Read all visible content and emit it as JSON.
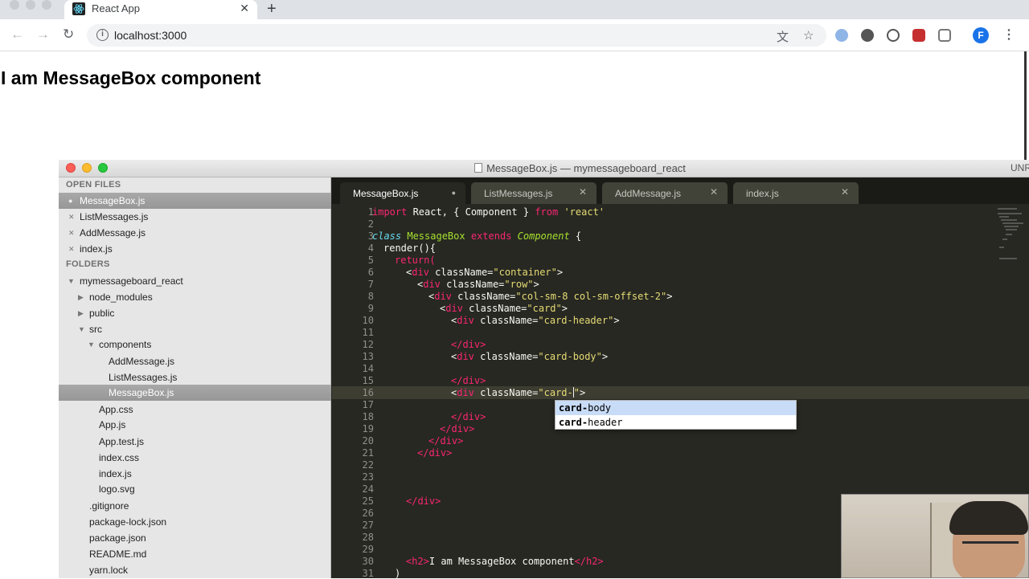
{
  "browser": {
    "tab_title": "React App",
    "tab_close": "✕",
    "new_tab": "+",
    "url": "localhost:3000",
    "profile_initial": "F",
    "back_icon": "←",
    "forward_icon": "→",
    "reload_icon": "↻",
    "translate_icon": "文",
    "bookmark_icon": "☆",
    "menu_icon": "⋮"
  },
  "page": {
    "heading": "I am MessageBox component"
  },
  "editor": {
    "window_title": "MessageBox.js — mymessageboard_react",
    "unregistered": "UNR",
    "sidebar": {
      "open_files_header": "OPEN FILES",
      "open_files": [
        {
          "name": "MessageBox.js",
          "mark": "●"
        },
        {
          "name": "ListMessages.js",
          "mark": "✕"
        },
        {
          "name": "AddMessage.js",
          "mark": "✕"
        },
        {
          "name": "index.js",
          "mark": "✕"
        }
      ],
      "folders_header": "FOLDERS",
      "tree": [
        {
          "name": "mymessageboard_react",
          "arrow": "▼"
        },
        {
          "name": "node_modules",
          "arrow": "▶"
        },
        {
          "name": "public",
          "arrow": "▶"
        },
        {
          "name": "src",
          "arrow": "▼"
        },
        {
          "name": "components",
          "arrow": "▼"
        },
        {
          "name": "AddMessage.js",
          "arrow": ""
        },
        {
          "name": "ListMessages.js",
          "arrow": ""
        },
        {
          "name": "MessageBox.js",
          "arrow": ""
        },
        {
          "name": "App.css",
          "arrow": ""
        },
        {
          "name": "App.js",
          "arrow": ""
        },
        {
          "name": "App.test.js",
          "arrow": ""
        },
        {
          "name": "index.css",
          "arrow": ""
        },
        {
          "name": "index.js",
          "arrow": ""
        },
        {
          "name": "logo.svg",
          "arrow": ""
        },
        {
          "name": ".gitignore",
          "arrow": ""
        },
        {
          "name": "package-lock.json",
          "arrow": ""
        },
        {
          "name": "package.json",
          "arrow": ""
        },
        {
          "name": "README.md",
          "arrow": ""
        },
        {
          "name": "yarn.lock",
          "arrow": ""
        }
      ]
    },
    "tabs": [
      {
        "label": "MessageBox.js",
        "close": "●"
      },
      {
        "label": "ListMessages.js",
        "close": "✕"
      },
      {
        "label": "AddMessage.js",
        "close": "✕"
      },
      {
        "label": "index.js",
        "close": "✕"
      }
    ],
    "line_numbers": [
      "1",
      "2",
      "3",
      "4",
      "5",
      "6",
      "7",
      "8",
      "9",
      "10",
      "11",
      "12",
      "13",
      "14",
      "15",
      "16",
      "17",
      "18",
      "19",
      "20",
      "21",
      "22",
      "23",
      "24",
      "25",
      "26",
      "27",
      "28",
      "29",
      "30",
      "31"
    ],
    "code": {
      "l1": {
        "kw1": "import",
        "mid": " React, { Component } ",
        "kw2": "from",
        "str": "'react'"
      },
      "l3": {
        "storage": "class",
        "name": "MessageBox",
        "kw": "extends",
        "parent": "Component",
        "brace": " {"
      },
      "l4": "render(){",
      "l5": "return(",
      "l6": {
        "pre": "<",
        "tag": "div",
        "attr": " className=",
        "val": "\"container\"",
        "post": ">"
      },
      "l7": {
        "val": "\"row\""
      },
      "l8": {
        "val": "\"col-sm-8 col-sm-offset-2\""
      },
      "l9": {
        "val": "\"card\""
      },
      "l10": {
        "val": "\"card-header\""
      },
      "l12": "</div>",
      "l13": {
        "val": "\"card-body\""
      },
      "l15": "</div>",
      "l16": {
        "val_before": "\"card-",
        "val_after": "\""
      },
      "l18": "</div>",
      "l19": "</div>",
      "l20": "</div>",
      "l21": "</div>",
      "l25": "</div>",
      "l30": {
        "open": "<h2>",
        "text": "I am MessageBox component",
        "close": "</h2>"
      },
      "l31": ")"
    },
    "autocomplete": [
      {
        "match": "card-",
        "rest": "body"
      },
      {
        "match": "card-",
        "rest": "header"
      }
    ]
  }
}
